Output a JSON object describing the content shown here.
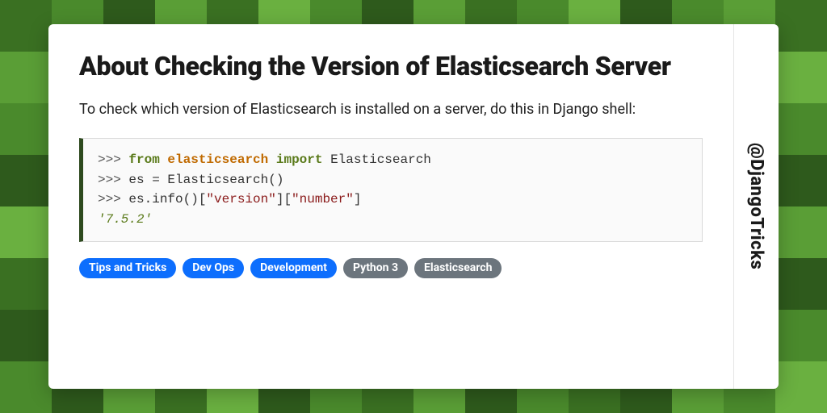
{
  "handle": "@DjangoTricks",
  "title": "About Checking the Version of Elasticsearch Server",
  "description": "To check which version of Elasticsearch is installed on a server, do this in Django shell:",
  "code": {
    "lines": [
      {
        "prompt": ">>> ",
        "kw1": "from",
        "mod": "elasticsearch",
        "kw2": "import",
        "id": "Elasticsearch"
      },
      {
        "prompt": ">>> ",
        "text": "es = Elasticsearch()"
      },
      {
        "prompt": ">>> ",
        "text_a": "es.info()[",
        "str_a": "\"version\"",
        "text_b": "][",
        "str_b": "\"number\"",
        "text_c": "]"
      },
      {
        "output": "'7.5.2'"
      }
    ]
  },
  "tags": [
    {
      "label": "Tips and Tricks",
      "cls": "tag-blue"
    },
    {
      "label": "Dev Ops",
      "cls": "tag-blue"
    },
    {
      "label": "Development",
      "cls": "tag-blue"
    },
    {
      "label": "Python 3",
      "cls": "tag-gray"
    },
    {
      "label": "Elasticsearch",
      "cls": "tag-gray"
    }
  ],
  "bg_pattern": [
    [
      1,
      2,
      0,
      3,
      1,
      4,
      2,
      0,
      3,
      1,
      2,
      4,
      0,
      2,
      3,
      1
    ],
    [
      3,
      0,
      2,
      1,
      4,
      0,
      3,
      2,
      1,
      4,
      0,
      1,
      3,
      0,
      2,
      4
    ],
    [
      2,
      4,
      1,
      0,
      2,
      3,
      1,
      4,
      0,
      2,
      3,
      0,
      1,
      4,
      0,
      2
    ],
    [
      0,
      1,
      3,
      2,
      0,
      1,
      4,
      0,
      2,
      1,
      4,
      2,
      0,
      3,
      1,
      0
    ],
    [
      4,
      2,
      0,
      1,
      3,
      2,
      0,
      3,
      1,
      0,
      2,
      4,
      1,
      0,
      2,
      3
    ],
    [
      1,
      3,
      2,
      4,
      0,
      1,
      2,
      0,
      4,
      3,
      1,
      0,
      2,
      1,
      4,
      0
    ],
    [
      0,
      4,
      1,
      0,
      2,
      3,
      1,
      2,
      0,
      1,
      3,
      2,
      4,
      0,
      1,
      2
    ],
    [
      2,
      0,
      3,
      1,
      4,
      0,
      2,
      1,
      3,
      0,
      2,
      1,
      0,
      3,
      2,
      4
    ]
  ]
}
